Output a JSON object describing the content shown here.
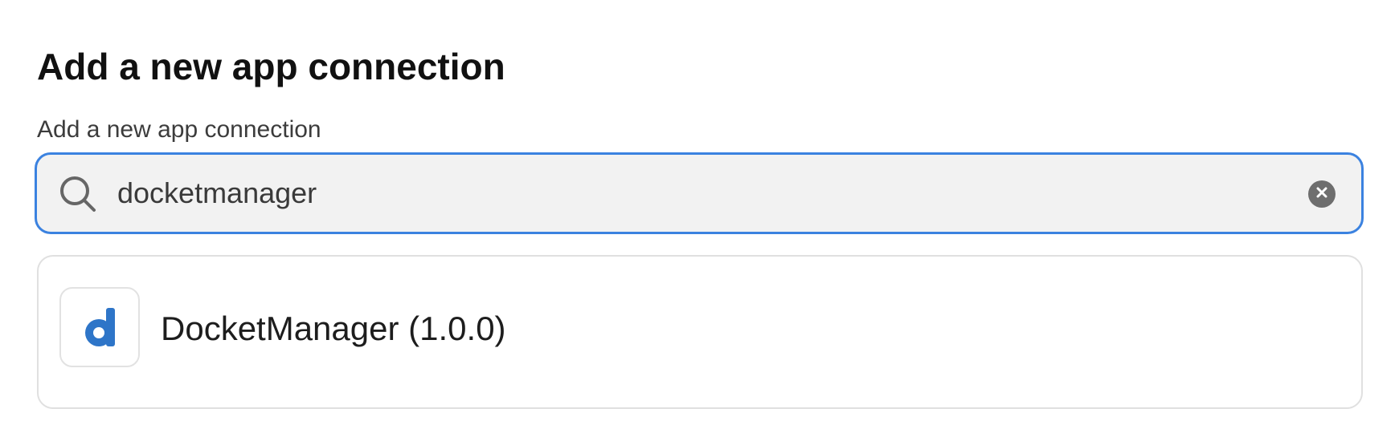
{
  "header": {
    "title": "Add a new app connection"
  },
  "search": {
    "label": "Add a new app connection",
    "value": "docketmanager",
    "clear_icon": "close-circle-icon",
    "search_icon": "search-icon"
  },
  "results": [
    {
      "name": "DocketManager (1.0.0)",
      "logo_letter": "d",
      "logo_color": "#2e75c8"
    }
  ],
  "colors": {
    "accent": "#3b82e0",
    "input_bg": "#f2f2f2"
  }
}
